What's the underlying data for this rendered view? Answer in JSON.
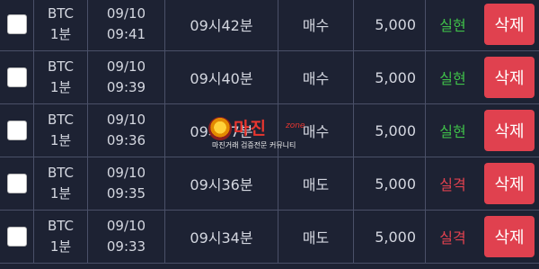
{
  "rows": [
    {
      "symbol": "BTC",
      "interval": "1분",
      "date": "09/10",
      "time": "09:41",
      "target": "09시42분",
      "side": "매수",
      "amount": "5,000",
      "result": "실현",
      "result_type": "win",
      "delete_label": "삭제"
    },
    {
      "symbol": "BTC",
      "interval": "1분",
      "date": "09/10",
      "time": "09:39",
      "target": "09시40분",
      "side": "매수",
      "amount": "5,000",
      "result": "실현",
      "result_type": "win",
      "delete_label": "삭제"
    },
    {
      "symbol": "BTC",
      "interval": "1분",
      "date": "09/10",
      "time": "09:36",
      "target": "09시37분",
      "side": "매수",
      "amount": "5,000",
      "result": "실현",
      "result_type": "win",
      "delete_label": "삭제"
    },
    {
      "symbol": "BTC",
      "interval": "1분",
      "date": "09/10",
      "time": "09:35",
      "target": "09시36분",
      "side": "매도",
      "amount": "5,000",
      "result": "실격",
      "result_type": "loss",
      "delete_label": "삭제"
    },
    {
      "symbol": "BTC",
      "interval": "1분",
      "date": "09/10",
      "time": "09:33",
      "target": "09시34분",
      "side": "매도",
      "amount": "5,000",
      "result": "실격",
      "result_type": "loss",
      "delete_label": "삭제"
    }
  ],
  "watermark": {
    "title": "마진",
    "sub_title": "zone",
    "tagline": "마진거래 검증전문 커뮤니티"
  },
  "colors": {
    "background": "#1d2233",
    "grid_line": "#4a5068",
    "text": "#d4d7e0",
    "win": "#3fbf49",
    "loss": "#e0414f",
    "delete_button": "#e0414f"
  }
}
